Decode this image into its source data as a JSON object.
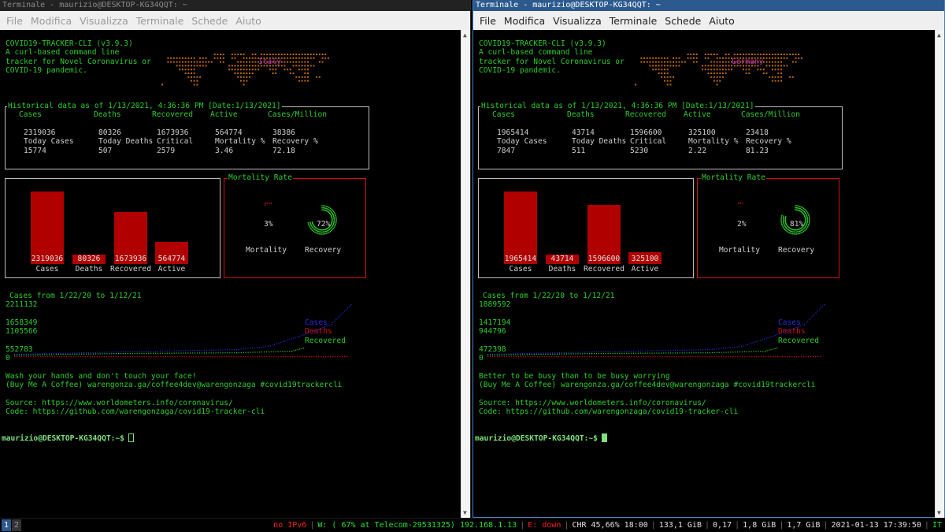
{
  "left": {
    "title": "Terminale - maurizio@DESKTOP-KG34QQT: ~",
    "menu": [
      "File",
      "Modifica",
      "Visualizza",
      "Terminale",
      "Schede",
      "Aiuto"
    ],
    "header": [
      "COVID19-TRACKER-CLI (v3.9.3)",
      "A curl-based command line",
      "tracker for Novel Coronavirus or",
      "COVID-19 pandemic."
    ],
    "country": "Italy",
    "hist_label": "Historical data as of 1/13/2021, 4:36:36 PM [Date:1/13/2021]",
    "cols": [
      "Cases",
      "Deaths",
      "Recovered",
      "Active",
      "Cases/Million"
    ],
    "row1": [
      "2319036",
      "80326",
      "1673936",
      "564774",
      "38386"
    ],
    "cols2": [
      "Today Cases",
      "Today Deaths",
      "Critical",
      "Mortality %",
      "Recovery %"
    ],
    "row2": [
      "15774",
      "507",
      "2579",
      "3.46",
      "72.18"
    ],
    "bars": [
      {
        "label": "Cases",
        "value": "2319036",
        "frac": 1.0
      },
      {
        "label": "Deaths",
        "value": "80326",
        "frac": 0.035
      },
      {
        "label": "Recovered",
        "value": "1673936",
        "frac": 0.722
      },
      {
        "label": "Active",
        "value": "564774",
        "frac": 0.3
      }
    ],
    "mortality_title": "Mortality Rate",
    "mortality_pct": "3%",
    "recovery_pct": "72%",
    "mortality_label": "Mortality",
    "recovery_label": "Recovery",
    "recovery_frac": 0.72,
    "mortality_frac": 0.03,
    "chart_title": "Cases from 1/22/20 to 1/12/21",
    "yticks": [
      "2211132",
      "1658349",
      "1105566",
      "552783",
      "0"
    ],
    "legend": [
      "Cases",
      "Deaths",
      "Recovered"
    ],
    "footer": [
      "Wash your hands and don't touch your face!",
      "(Buy Me A Coffee) warengonza.ga/coffee4dev@warengonzaga #covid19trackercli",
      "",
      "Source: https://www.worldometers.info/coronavirus/",
      "Code: https://github.com/warengonzaga/covid19-tracker-cli"
    ],
    "prompt": "maurizio@DESKTOP-KG34QQT:~$"
  },
  "right": {
    "title": "Terminale - maurizio@DESKTOP-KG34QQT: ~",
    "menu": [
      "File",
      "Modifica",
      "Visualizza",
      "Terminale",
      "Schede",
      "Aiuto"
    ],
    "header": [
      "COVID19-TRACKER-CLI (v3.9.3)",
      "A curl-based command line",
      "tracker for Novel Coronavirus or",
      "COVID-19 pandemic."
    ],
    "country": "Germany",
    "hist_label": "Historical data as of 1/13/2021, 4:36:36 PM [Date:1/13/2021]",
    "cols": [
      "Cases",
      "Deaths",
      "Recovered",
      "Active",
      "Cases/Million"
    ],
    "row1": [
      "1965414",
      "43714",
      "1596600",
      "325100",
      "23418"
    ],
    "cols2": [
      "Today Cases",
      "Today Deaths",
      "Critical",
      "Mortality %",
      "Recovery %"
    ],
    "row2": [
      "7847",
      "511",
      "5230",
      "2.22",
      "81.23"
    ],
    "bars": [
      {
        "label": "Cases",
        "value": "1965414",
        "frac": 1.0
      },
      {
        "label": "Deaths",
        "value": "43714",
        "frac": 0.022
      },
      {
        "label": "Recovered",
        "value": "1596600",
        "frac": 0.812
      },
      {
        "label": "Active",
        "value": "325100",
        "frac": 0.165
      }
    ],
    "mortality_title": "Mortality Rate",
    "mortality_pct": "2%",
    "recovery_pct": "81%",
    "mortality_label": "Mortality",
    "recovery_label": "Recovery",
    "recovery_frac": 0.81,
    "mortality_frac": 0.02,
    "chart_title": "Cases from 1/22/20 to 1/12/21",
    "yticks": [
      "1889592",
      "1417194",
      "944796",
      "472398",
      "0"
    ],
    "legend": [
      "Cases",
      "Deaths",
      "Recovered"
    ],
    "footer": [
      "Better to be busy than to be busy worrying",
      "(Buy Me A Coffee) warengonza.ga/coffee4dev@warengonzaga #covid19trackercli",
      "",
      "Source: https://www.worldometers.info/coronavirus/",
      "Code: https://github.com/warengonzaga/covid19-tracker-cli"
    ],
    "prompt": "maurizio@DESKTOP-KG34QQT:~$"
  },
  "taskbar": {
    "workspaces": [
      "1",
      "2"
    ],
    "status": [
      "no IPv6",
      "W: ( 67% at Telecom-29531325) 192.168.1.13",
      "E: down",
      "CHR 45,66% 18:00",
      "133,1 GiB",
      "0,17",
      "1,8 GiB",
      "1,7 GiB",
      "2021-01-13 17:39:50",
      "IT"
    ],
    "colors": {
      "red": "#ff2020",
      "green": "#2ee02e",
      "white": "#e0e0e0"
    }
  }
}
